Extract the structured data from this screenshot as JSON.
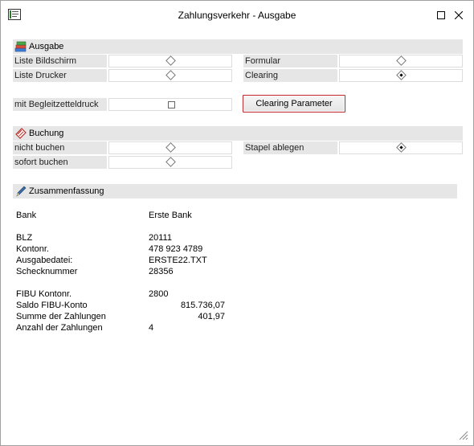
{
  "window": {
    "title": "Zahlungsverkehr - Ausgabe"
  },
  "ausgabe": {
    "header": "Ausgabe",
    "rows": [
      {
        "label": "Liste Bildschirm",
        "selected": false
      },
      {
        "label": "Liste Drucker",
        "selected": false
      },
      {
        "label": "Formular",
        "selected": false
      },
      {
        "label": "Clearing",
        "selected": true
      }
    ],
    "begleit_label": "mit Begleitzetteldruck",
    "begleit_checked": false,
    "clearing_button": "Clearing Parameter"
  },
  "buchung": {
    "header": "Buchung",
    "rows": [
      {
        "label": "nicht buchen",
        "selected": false
      },
      {
        "label": "sofort buchen",
        "selected": false
      },
      {
        "label": "Stapel ablegen",
        "selected": true
      }
    ]
  },
  "summary": {
    "header": "Zusammenfassung",
    "bank_label": "Bank",
    "bank_value": "Erste Bank",
    "blz_label": "BLZ",
    "blz_value": "20111",
    "konto_label": "Kontonr.",
    "konto_value": "478 923 4789",
    "datei_label": "Ausgabedatei:",
    "datei_value": "ERSTE22.TXT",
    "scheck_label": "Schecknummer",
    "scheck_value": "28356",
    "fibu_label": "FIBU Kontonr.",
    "fibu_value": "2800",
    "saldo_label": "Saldo FIBU-Konto",
    "saldo_value": "815.736,07",
    "summe_label": "Summe der Zahlungen",
    "summe_value": "401,97",
    "anzahl_label": "Anzahl der Zahlungen",
    "anzahl_value": "4"
  }
}
